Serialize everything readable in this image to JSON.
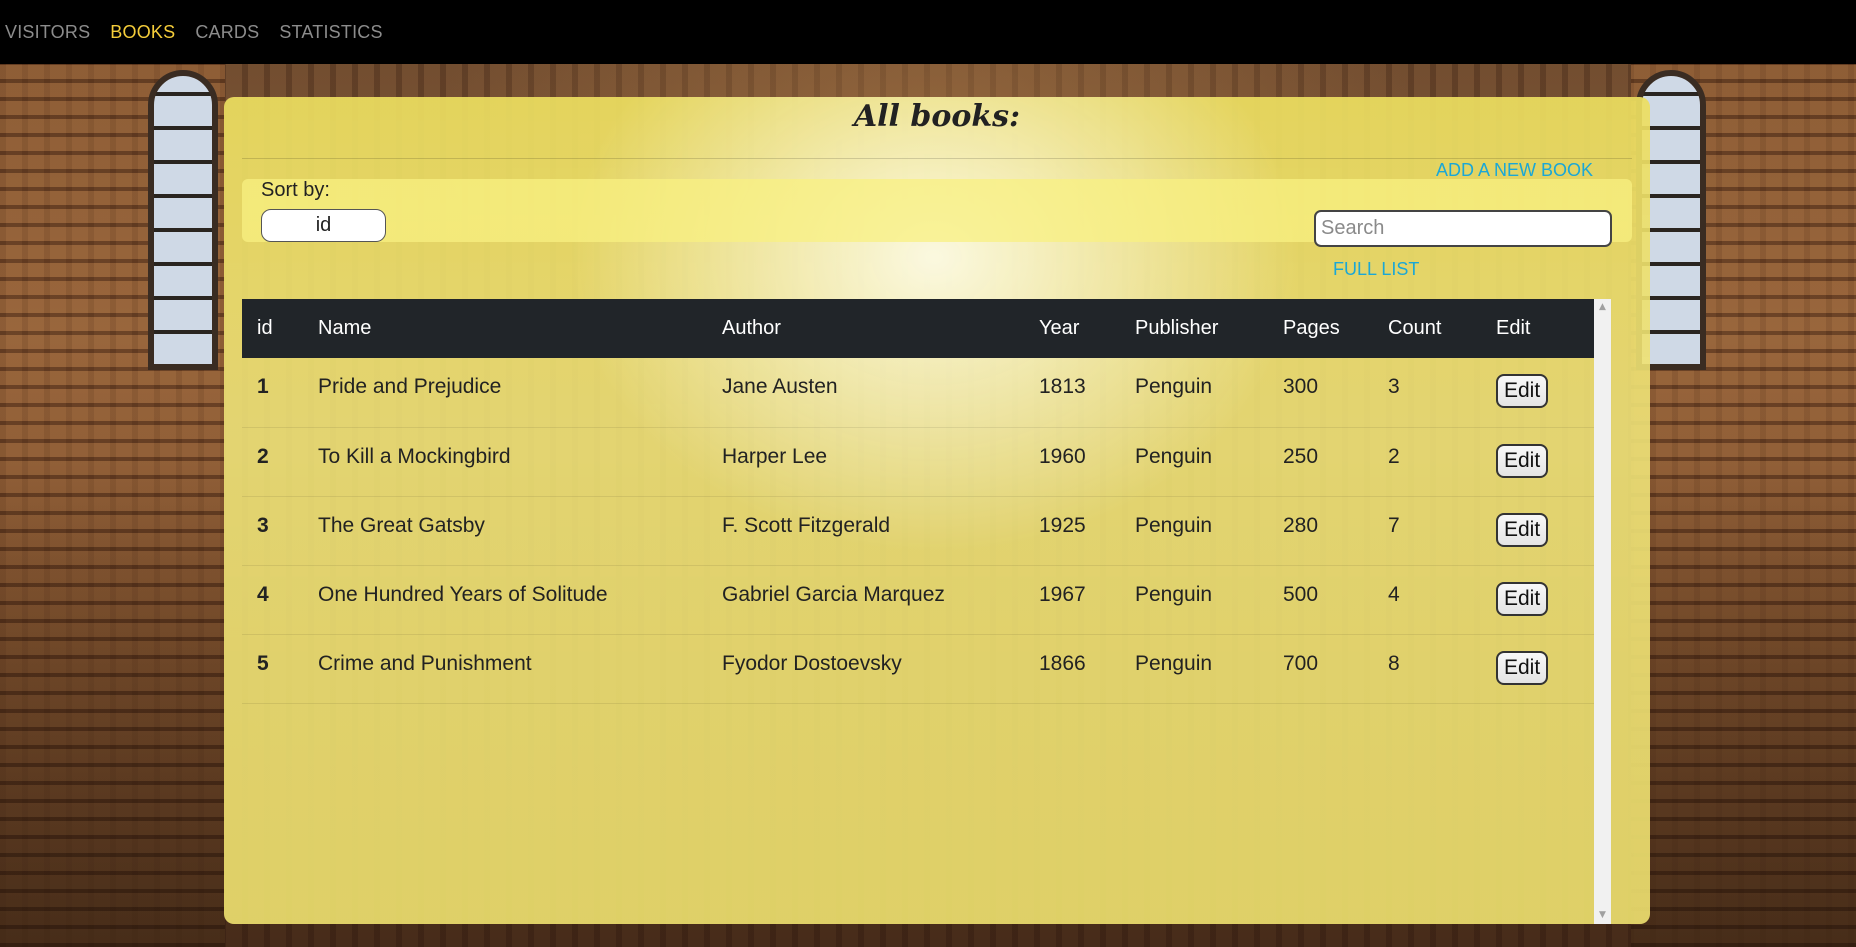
{
  "nav": {
    "items": [
      {
        "label": "VISITORS",
        "active": false
      },
      {
        "label": "BOOKS",
        "active": true
      },
      {
        "label": "CARDS",
        "active": false
      },
      {
        "label": "STATISTICS",
        "active": false
      }
    ]
  },
  "page": {
    "title": "All books:",
    "add_link": "ADD A NEW BOOK",
    "full_list_link": "FULL LIST"
  },
  "sort": {
    "label": "Sort by:",
    "value": "id"
  },
  "search": {
    "placeholder": "Search",
    "value": ""
  },
  "table": {
    "columns": [
      "id",
      "Name",
      "Author",
      "Year",
      "Publisher",
      "Pages",
      "Count",
      "Edit"
    ],
    "edit_label": "Edit",
    "rows": [
      {
        "id": "1",
        "name": "Pride and Prejudice",
        "author": "Jane Austen",
        "year": "1813",
        "publisher": "Penguin",
        "pages": "300",
        "count": "3"
      },
      {
        "id": "2",
        "name": "To Kill a Mockingbird",
        "author": "Harper Lee",
        "year": "1960",
        "publisher": "Penguin",
        "pages": "250",
        "count": "2"
      },
      {
        "id": "3",
        "name": "The Great Gatsby",
        "author": "F. Scott Fitzgerald",
        "year": "1925",
        "publisher": "Penguin",
        "pages": "280",
        "count": "7"
      },
      {
        "id": "4",
        "name": "One Hundred Years of Solitude",
        "author": "Gabriel Garcia Marquez",
        "year": "1967",
        "publisher": "Penguin",
        "pages": "500",
        "count": "4"
      },
      {
        "id": "5",
        "name": "Crime and Punishment",
        "author": "Fyodor Dostoevsky",
        "year": "1866",
        "publisher": "Penguin",
        "pages": "700",
        "count": "8"
      }
    ]
  },
  "colors": {
    "nav_active": "#f5cd3a",
    "nav_inactive": "#8c8c8c",
    "link": "#1aa7d6",
    "table_header_bg": "#212529"
  }
}
